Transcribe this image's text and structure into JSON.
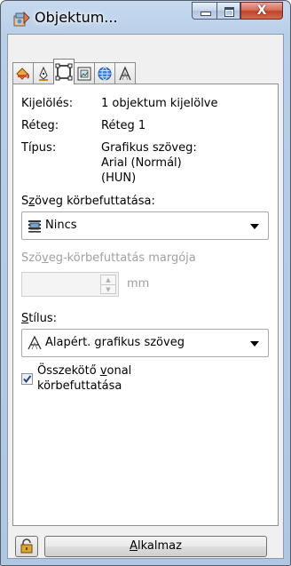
{
  "window": {
    "title": "Objektum...",
    "icon": "object-properties-icon",
    "close_glyph": "X"
  },
  "tabs": [
    {
      "icon": "fill-bucket-icon"
    },
    {
      "icon": "pen-nib-icon"
    },
    {
      "icon": "summary-square-icon",
      "active": true
    },
    {
      "icon": "bitmap-frame-icon"
    },
    {
      "icon": "internet-globe-icon"
    },
    {
      "icon": "text-a-icon"
    }
  ],
  "summary": {
    "selection_label": "Kijelölés:",
    "selection_value": "1 objektum kijelölve",
    "layer_label": "Réteg:",
    "layer_value": "Réteg 1",
    "type_label": "Típus:",
    "type_value": "Grafikus szöveg:\nArial (Normál)\n(HUN)"
  },
  "wrap": {
    "label_pre": "S",
    "label_u": "z",
    "label_post": "öveg körbefuttatása:",
    "value": "Nincs"
  },
  "margin": {
    "label_pre": "Szö",
    "label_u": "v",
    "label_post": "eg-körbefuttatás margója",
    "value": "",
    "unit": "mm"
  },
  "style": {
    "label_pre": "",
    "label_u": "S",
    "label_post": "tílus:",
    "value": "Alapért. grafikus szöveg"
  },
  "connector": {
    "checked": true,
    "label_pre": "Összekötő ",
    "label_u": "v",
    "label_post": "onal",
    "label_line2": "körbefuttatása"
  },
  "footer": {
    "apply_pre": "",
    "apply_u": "A",
    "apply_post": "lkalmaz"
  }
}
